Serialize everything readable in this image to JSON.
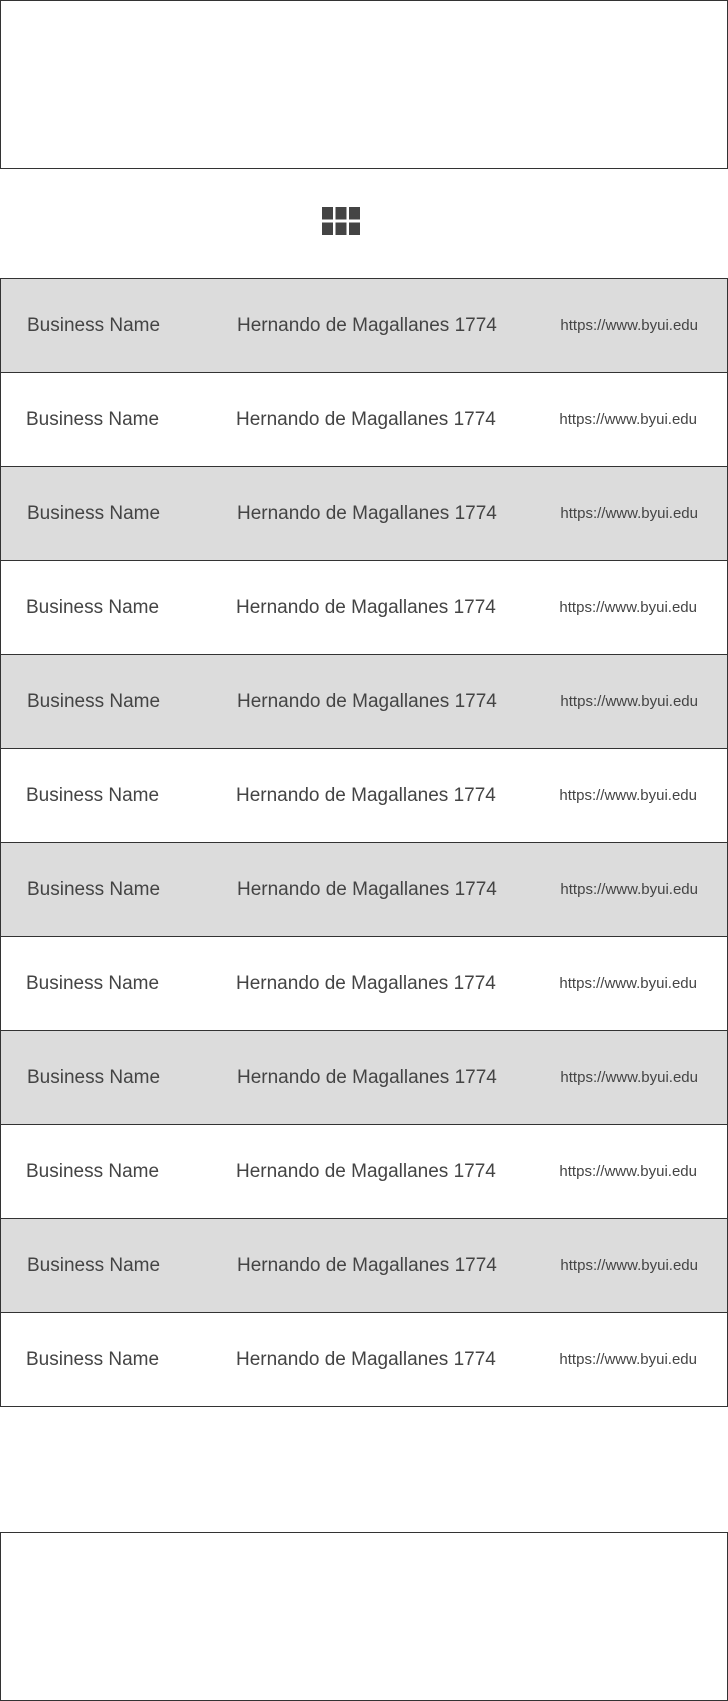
{
  "header": {
    "content": ""
  },
  "view_toggle": {
    "icon": "grid-icon",
    "color": "#444444"
  },
  "directory": {
    "rows": [
      {
        "name": "Business Name",
        "address": "Hernando de Magallanes 1774",
        "url": "https://www.byui.edu"
      },
      {
        "name": "Business Name",
        "address": "Hernando de Magallanes 1774",
        "url": "https://www.byui.edu"
      },
      {
        "name": "Business Name",
        "address": "Hernando de Magallanes 1774",
        "url": "https://www.byui.edu"
      },
      {
        "name": "Business Name",
        "address": "Hernando de Magallanes 1774",
        "url": "https://www.byui.edu"
      },
      {
        "name": "Business Name",
        "address": "Hernando de Magallanes 1774",
        "url": "https://www.byui.edu"
      },
      {
        "name": "Business Name",
        "address": "Hernando de Magallanes 1774",
        "url": "https://www.byui.edu"
      },
      {
        "name": "Business Name",
        "address": "Hernando de Magallanes 1774",
        "url": "https://www.byui.edu"
      },
      {
        "name": "Business Name",
        "address": "Hernando de Magallanes 1774",
        "url": "https://www.byui.edu"
      },
      {
        "name": "Business Name",
        "address": "Hernando de Magallanes 1774",
        "url": "https://www.byui.edu"
      },
      {
        "name": "Business Name",
        "address": "Hernando de Magallanes 1774",
        "url": "https://www.byui.edu"
      },
      {
        "name": "Business Name",
        "address": "Hernando de Magallanes 1774",
        "url": "https://www.byui.edu"
      },
      {
        "name": "Business Name",
        "address": "Hernando de Magallanes 1774",
        "url": "https://www.byui.edu"
      }
    ]
  },
  "colors": {
    "row_shaded": "#dcdcdc",
    "row_plain": "#ffffff",
    "border": "#333333",
    "text": "#444444"
  },
  "footer": {
    "content": ""
  }
}
